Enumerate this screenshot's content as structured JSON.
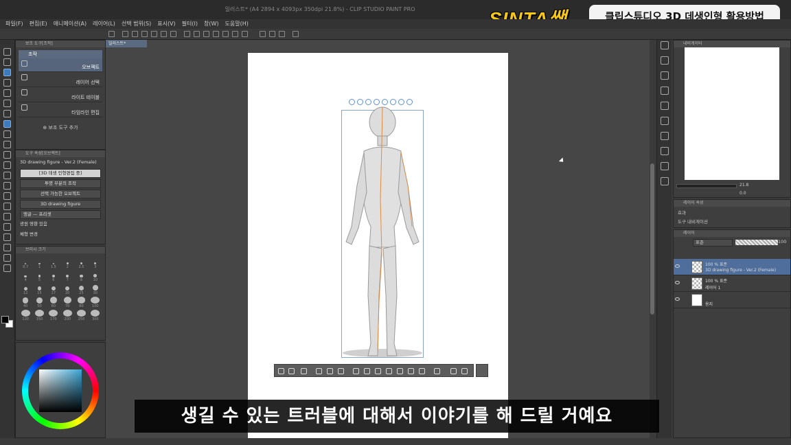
{
  "window": {
    "title": "일러스트* (A4 2894 x 4093px 350dpi 21.8%) - CLIP STUDIO PAINT PRO"
  },
  "overlay": {
    "brand": "SINTA쌤",
    "topic": "클립스튜디오 3D 데생인형 활용방법",
    "subtitle": "생길 수 있는 트러블에 대해서 이야기를 해 드릴 거예요"
  },
  "menu": [
    "파일(F)",
    "편집(E)",
    "애니메이션(A)",
    "레이어(L)",
    "선택 범위(S)",
    "표시(V)",
    "필터(I)",
    "창(W)",
    "도움말(H)"
  ],
  "subtool": {
    "header": "보조 도구[조작]",
    "group": "조작",
    "items": [
      "오브젝트",
      "레이어 선택",
      "라이트 테이블",
      "타임라인 편집"
    ],
    "add": "보조 도구 추가"
  },
  "toolprop": {
    "header": "도구 속성[오브젝트]",
    "object_name": "3D drawing figure - Ver.2 (Female)",
    "edit_button": "[3D 데생 인형편집 중]",
    "rows": [
      "투명 부분의 조작",
      "선택 가능한 오브젝트"
    ],
    "layer_item": "3D drawing figure",
    "camera_label": "앵글",
    "preset_label": "프리셋",
    "light_label": "광원 영향 있음",
    "body_label": "체형 변경"
  },
  "brushsize": {
    "header": "브러시 크기",
    "sizes": [
      "0.7",
      "1",
      "1.5",
      "2",
      "2.5",
      "3",
      "4",
      "5",
      "6",
      "7",
      "8",
      "10",
      "12",
      "15",
      "17",
      "20",
      "25",
      "30",
      "40",
      "50",
      "60",
      "70",
      "80",
      "100",
      "120",
      "150",
      "170",
      "200",
      "250",
      "300"
    ]
  },
  "canvas": {
    "tab": "일러스트*"
  },
  "navigator": {
    "header": "내비게이터",
    "zoom": "21.8",
    "rotation": "0.0"
  },
  "properties": {
    "header": "레이어 속성",
    "effect": "효과",
    "tool_nav": "도구 내비게이션"
  },
  "layers": {
    "header": "레이어",
    "blend_mode": "표준",
    "opacity": "100",
    "rows": [
      {
        "mode": "100 % 표준",
        "name": "3D drawing figure - Ver.2 (Female)"
      },
      {
        "mode": "100 % 표준",
        "name": "레이어 1"
      },
      {
        "mode": "",
        "name": "용지"
      }
    ]
  },
  "colors": {
    "accent": "#4f6e9b",
    "brand": "#f5c518"
  }
}
